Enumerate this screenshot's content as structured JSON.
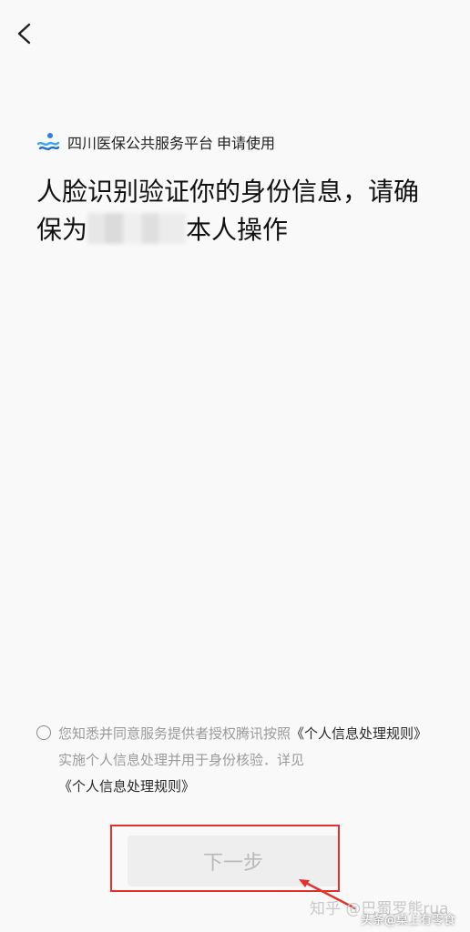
{
  "nav": {
    "back_icon": "chevron-left-icon"
  },
  "app": {
    "logo_icon": "sichuan-health-logo-icon",
    "name": "四川医保公共服务平台",
    "action": "申请使用"
  },
  "headline": {
    "line1": "人脸识别验证你的身份信息，请确",
    "prefix": "保为",
    "suffix": "本人操作"
  },
  "agreement": {
    "text_before": "您知悉并同意服务提供者授权腾讯按照",
    "link1": "《个人信息处理规则》",
    "text_middle": "实施个人信息处理并用于身份核验．详见",
    "link2": "《个人信息处理规则》"
  },
  "buttons": {
    "next_label": "下一步"
  },
  "annotations": {
    "highlight_color": "#e0312d"
  },
  "watermarks": {
    "zhihu": "知乎 @巴蜀罗熊rua",
    "toutiao": "头条@桌上有零食"
  }
}
